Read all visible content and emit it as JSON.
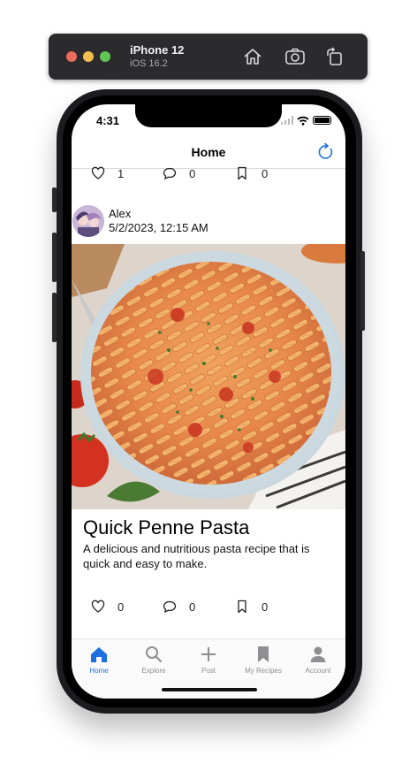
{
  "simulator": {
    "device": "iPhone 12",
    "os": "iOS 16.2"
  },
  "status_bar": {
    "time": "4:31"
  },
  "nav": {
    "title": "Home"
  },
  "previous_post_actions": {
    "likes": "1",
    "comments": "0",
    "saves": "0"
  },
  "post": {
    "author": "Alex",
    "date": "5/2/2023, 12:15 AM",
    "title": "Quick Penne Pasta",
    "description": "A delicious and nutritious pasta recipe that is quick and easy to make.",
    "actions": {
      "likes": "0",
      "comments": "0",
      "saves": "0"
    }
  },
  "tabs": [
    {
      "label": "Home",
      "icon": "house-icon",
      "active": true
    },
    {
      "label": "Explore",
      "icon": "magnifier-icon",
      "active": false
    },
    {
      "label": "Post",
      "icon": "plus-icon",
      "active": false
    },
    {
      "label": "My Recipes",
      "icon": "bookmark-icon",
      "active": false
    },
    {
      "label": "Account",
      "icon": "person-icon",
      "active": false
    }
  ],
  "colors": {
    "accent": "#1b6fe0",
    "tab_inactive": "#8e8e93"
  }
}
